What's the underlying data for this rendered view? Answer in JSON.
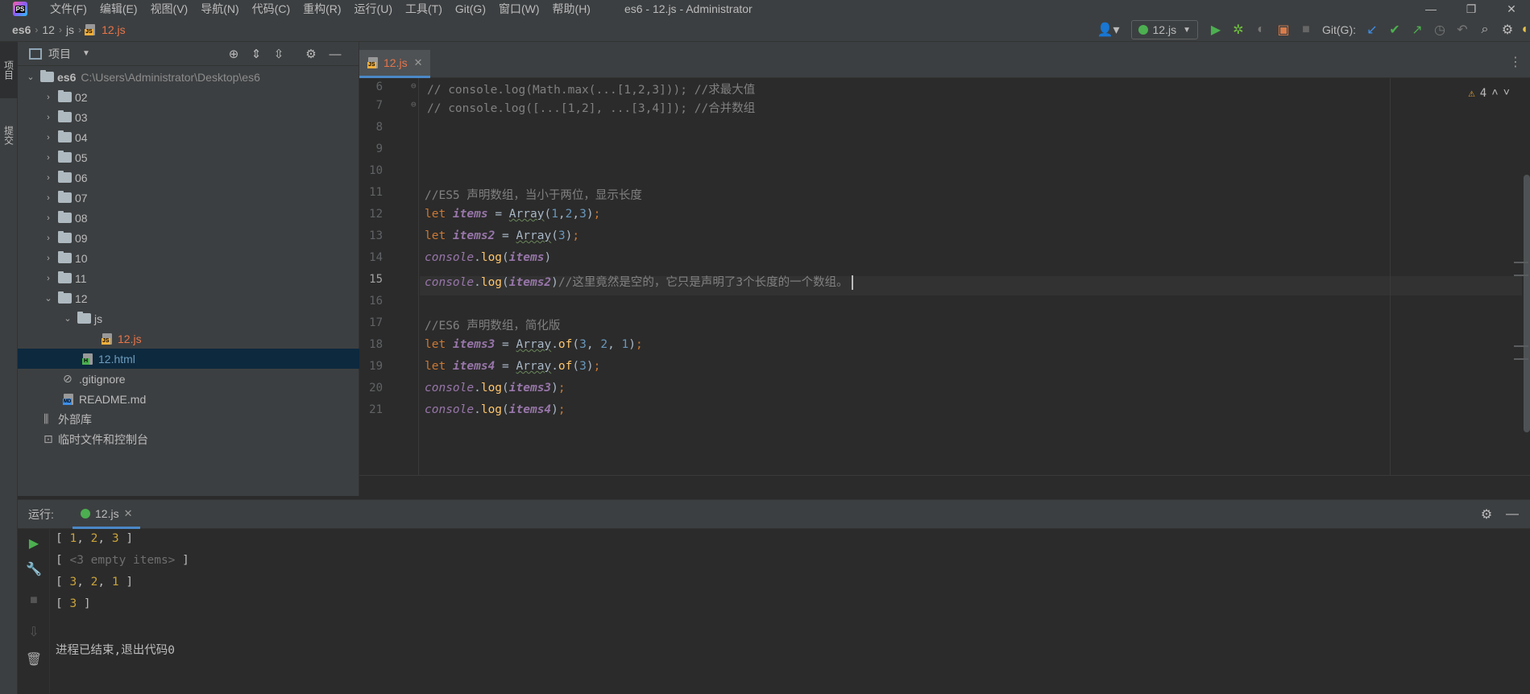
{
  "menubar": {
    "logo": "PS",
    "items": [
      "文件(F)",
      "编辑(E)",
      "视图(V)",
      "导航(N)",
      "代码(C)",
      "重构(R)",
      "运行(U)",
      "工具(T)",
      "Git(G)",
      "窗口(W)",
      "帮助(H)"
    ],
    "title": "es6 - 12.js - Administrator",
    "minimize": "—",
    "restore": "❐",
    "close": "✕"
  },
  "breadcrumb": {
    "items": [
      "es6",
      "12",
      "js",
      "12.js"
    ]
  },
  "toolbar": {
    "run_config": "12.js",
    "git_label": "Git(G):"
  },
  "left_strip": {
    "project_tab": "项目",
    "commit_tab": "提交"
  },
  "project": {
    "title": "项目",
    "root_name": "es6",
    "root_path": "C:\\Users\\Administrator\\Desktop\\es6",
    "folders": [
      "02",
      "03",
      "04",
      "05",
      "06",
      "07",
      "08",
      "09",
      "10",
      "11"
    ],
    "open_folder": "12",
    "sub_folder": "js",
    "js_file": "12.js",
    "html_file": "12.html",
    "gitignore": ".gitignore",
    "readme": "README.md",
    "external_libs": "外部库",
    "scratches": "临时文件和控制台"
  },
  "editor": {
    "tab_label": "12.js",
    "warnings": "4",
    "line_numbers": [
      "6",
      "7",
      "8",
      "9",
      "10",
      "11",
      "12",
      "13",
      "14",
      "15",
      "16",
      "17",
      "18",
      "19",
      "20",
      "21"
    ],
    "comment_6": "// console.log(Math.max(...[1,2,3])); //求最大值",
    "comment_7": "// console.log([...[1,2], ...[3,4]]); //合并数组",
    "comment_11": "//ES5 声明数组，当小于两位，显示长度",
    "comment_15": "//这里竟然是空的，它只是声明了3个长度的一个数组。",
    "comment_17": "//ES6 声明数组，简化版",
    "kw_let": "let",
    "var_items": "items",
    "var_items2": "items2",
    "var_items3": "items3",
    "var_items4": "items4",
    "console": "console",
    "log": "log",
    "array": "Array",
    "of": "of"
  },
  "run": {
    "label": "运行:",
    "tab_label": "12.js",
    "output": {
      "line1_nums": [
        "1",
        "2",
        "3"
      ],
      "line2_text": "<3 empty items>",
      "line3_nums": [
        "3",
        "2",
        "1"
      ],
      "line4_nums": [
        "3"
      ],
      "exit_message": "进程已结束,退出代码0"
    }
  },
  "colors": {
    "background": "#2b2b2b",
    "panel": "#3c3f41",
    "keyword": "#cc7832",
    "variable": "#9876aa",
    "number": "#6897bb",
    "comment": "#808080",
    "selection": "#0d293e",
    "accent": "#4a88c7"
  }
}
